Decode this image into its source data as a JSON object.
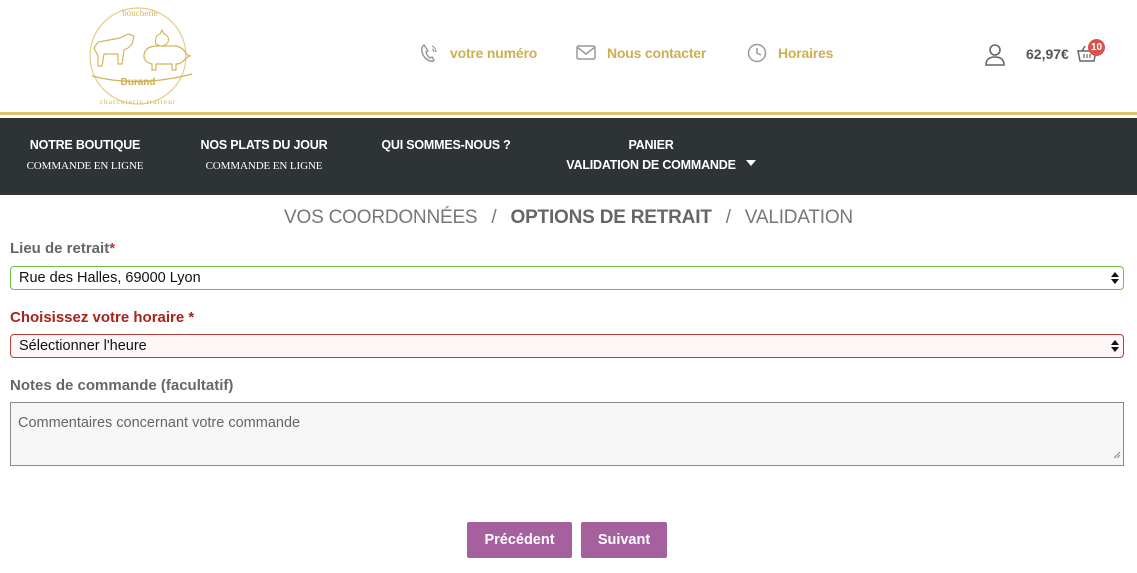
{
  "header": {
    "logo": {
      "top_text": "boucherie",
      "name": "Durand",
      "bottom_text": "charcuterie traiteur"
    },
    "contacts": {
      "phone": "votre numéro",
      "mail": "Nous contacter",
      "hours": "Horaires"
    },
    "cart": {
      "total": "62,97€",
      "count": "10"
    }
  },
  "nav": {
    "items": [
      {
        "line1": "NOTRE BOUTIQUE",
        "line2": "COMMANDE EN LIGNE"
      },
      {
        "line1": "NOS PLATS DU JOUR",
        "line2": "COMMANDE EN LIGNE"
      },
      {
        "line1": "QUI SOMMES-NOUS ?"
      },
      {
        "line1": "PANIER",
        "line2": "VALIDATION DE COMMANDE"
      }
    ]
  },
  "steps": {
    "step1": "VOS COORDONNÉES",
    "step2": "OPTIONS DE RETRAIT",
    "step3": "VALIDATION",
    "separator": "/",
    "active": "OPTIONS DE RETRAIT"
  },
  "form": {
    "lieu": {
      "label": "Lieu de retrait",
      "required_mark": "*",
      "value": "Rue des Halles, 69000 Lyon"
    },
    "horaire": {
      "label": "Choisissez votre horaire",
      "required_mark": "*",
      "value": "Sélectionner l'heure"
    },
    "notes": {
      "label": "Notes de commande (facultatif)",
      "placeholder": "Commentaires concernant votre commande"
    }
  },
  "buttons": {
    "prev": "Précédent",
    "next": "Suivant"
  },
  "colors": {
    "gold": "#cfae52",
    "nav_bg": "#2e3436",
    "button": "#a4619d",
    "valid_border": "#6cc04a",
    "error": "#a8231a",
    "badge": "#d9534f"
  },
  "icons": {
    "phone": "phone-icon",
    "mail": "envelope-icon",
    "hours": "clock-icon",
    "account": "user-icon",
    "cart": "basket-icon",
    "caret": "caret-down-icon"
  }
}
